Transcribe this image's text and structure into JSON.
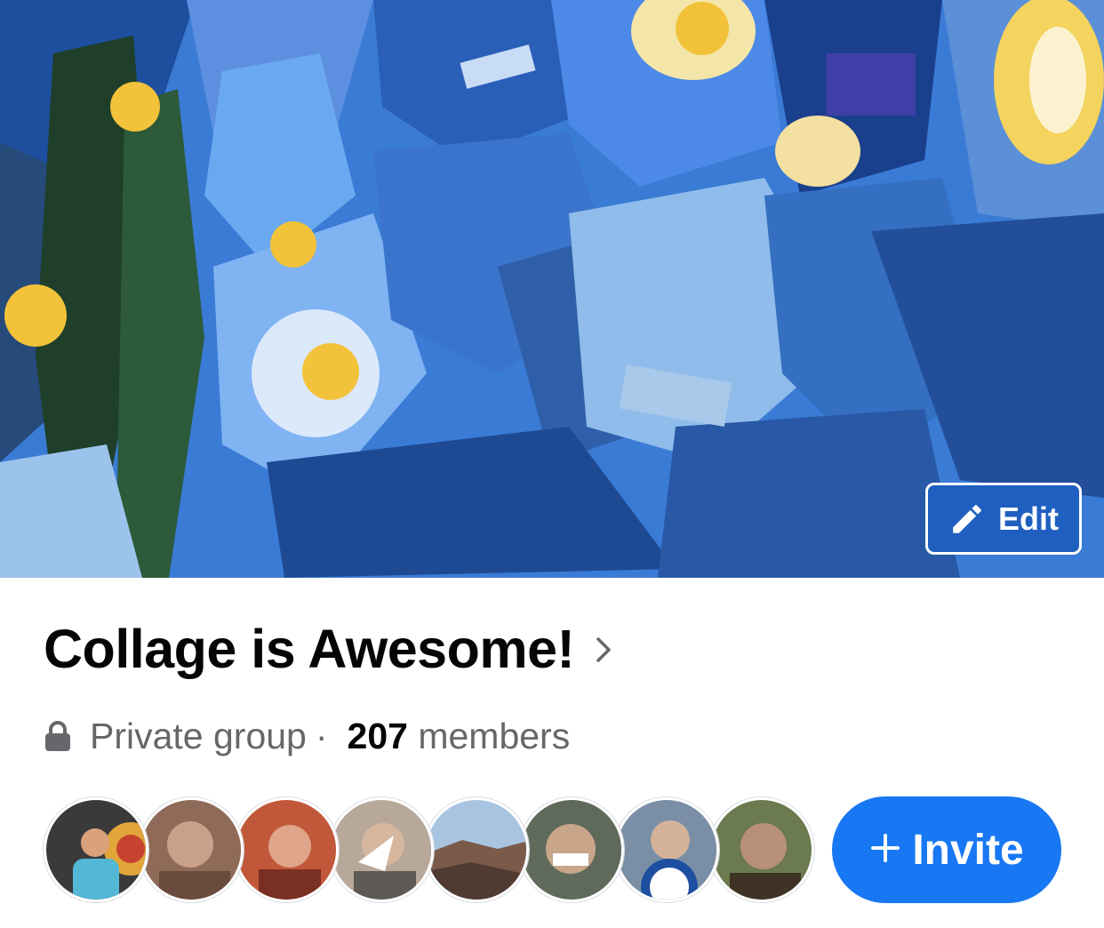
{
  "cover": {
    "edit_label": "Edit"
  },
  "group": {
    "name": "Collage is Awesome!",
    "privacy": "Private group",
    "separator": "·",
    "member_count": "207",
    "member_suffix": "members"
  },
  "actions": {
    "invite_label": "Invite"
  },
  "colors": {
    "accent": "#1877f2",
    "secondary_text": "#65676b",
    "primary_text": "#050505"
  },
  "icons": {
    "edit": "pencil-icon",
    "chevron": "chevron-right-icon",
    "privacy": "lock-icon",
    "invite": "plus-icon"
  }
}
